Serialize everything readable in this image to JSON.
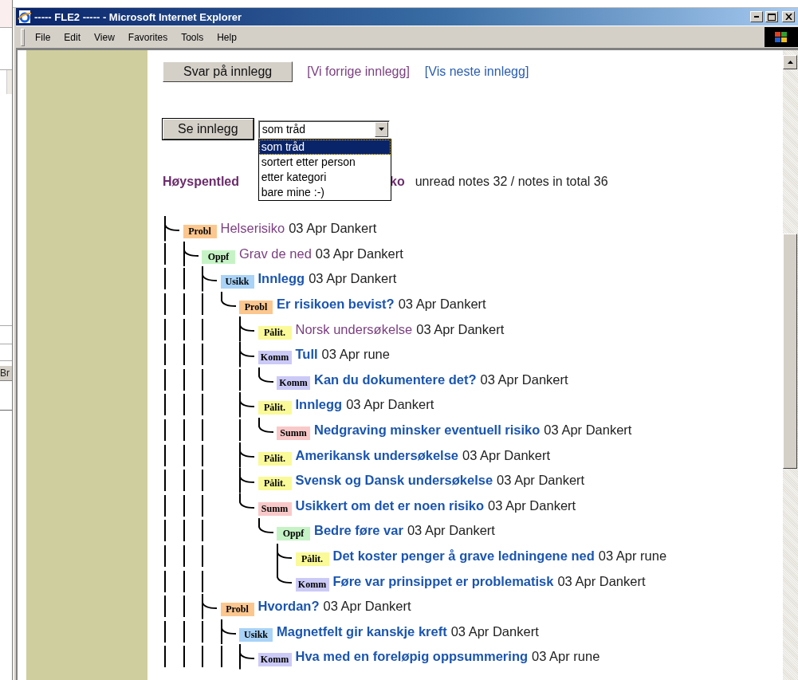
{
  "background_window": {
    "button_fragment": "Br"
  },
  "window": {
    "title": "----- FLE2 ----- - Microsoft Internet Explorer"
  },
  "menu": [
    "File",
    "Edit",
    "View",
    "Favorites",
    "Tools",
    "Help"
  ],
  "actions": {
    "reply_button": "Svar på innlegg",
    "links": [
      {
        "label": "[Vi forrige innlegg]",
        "visited": true
      },
      {
        "label": "[Vis neste innlegg]",
        "visited": false
      }
    ]
  },
  "view_form": {
    "button": "Se innlegg",
    "select_value": "som tråd",
    "options": [
      {
        "label": "som tråd",
        "selected": true
      },
      {
        "label": "sortert etter person",
        "selected": false
      },
      {
        "label": "etter kategori",
        "selected": false
      },
      {
        "label": "bare mine :-)",
        "selected": false
      }
    ]
  },
  "heading": {
    "title_start": "Høyspentled",
    "title_end": "ko",
    "counts": "unread notes 32 / notes in total 36"
  },
  "thread": [
    {
      "tag": "Probl",
      "color": "#fbc78f",
      "title": "Helserisiko",
      "meta": "03 Apr Dankert",
      "read": true,
      "last": false,
      "children": [
        {
          "tag": "Oppf",
          "color": "#c6f3c6",
          "title": "Grav de ned",
          "meta": "03 Apr Dankert",
          "read": true,
          "last": false,
          "children": [
            {
              "tag": "Usikk",
              "color": "#a9d3f7",
              "title": "Innlegg",
              "meta": "03 Apr Dankert",
              "read": false,
              "last": false,
              "children": [
                {
                  "tag": "Probl",
                  "color": "#fbc78f",
                  "title": "Er risikoen bevist?",
                  "meta": "03 Apr Dankert",
                  "read": false,
                  "last": true,
                  "children": [
                    {
                      "tag": "Pålit.",
                      "color": "#fafa98",
                      "title": "Norsk undersøkelse",
                      "meta": "03 Apr Dankert",
                      "read": true,
                      "last": false
                    },
                    {
                      "tag": "Komm",
                      "color": "#cbcaf7",
                      "title": "Tull",
                      "meta": "03 Apr rune",
                      "read": false,
                      "last": false,
                      "children": [
                        {
                          "tag": "Komm",
                          "color": "#cbcaf7",
                          "title": "Kan du dokumentere det?",
                          "meta": "03 Apr Dankert",
                          "read": false,
                          "last": true
                        }
                      ]
                    },
                    {
                      "tag": "Pålit.",
                      "color": "#fafa98",
                      "title": "Innlegg",
                      "meta": "03 Apr Dankert",
                      "read": false,
                      "last": false,
                      "children": [
                        {
                          "tag": "Summ",
                          "color": "#f9c9c9",
                          "title": "Nedgraving minsker eventuell risiko",
                          "meta": "03 Apr Dankert",
                          "read": false,
                          "last": true
                        }
                      ]
                    },
                    {
                      "tag": "Pålit.",
                      "color": "#fafa98",
                      "title": "Amerikansk undersøkelse",
                      "meta": "03 Apr Dankert",
                      "read": false,
                      "last": false
                    },
                    {
                      "tag": "Pålit.",
                      "color": "#fafa98",
                      "title": "Svensk og Dansk undersøkelse",
                      "meta": "03 Apr Dankert",
                      "read": false,
                      "last": false
                    },
                    {
                      "tag": "Summ",
                      "color": "#f9c9c9",
                      "title": "Usikkert om det er noen risiko",
                      "meta": "03 Apr Dankert",
                      "read": false,
                      "last": true,
                      "children": [
                        {
                          "tag": "Oppf",
                          "color": "#c6f3c6",
                          "title": "Bedre føre var",
                          "meta": "03 Apr Dankert",
                          "read": false,
                          "last": true,
                          "children": [
                            {
                              "tag": "Pålit.",
                              "color": "#fafa98",
                              "title": "Det koster penger å grave ledningene ned",
                              "meta": "03 Apr rune",
                              "read": false,
                              "last": false
                            },
                            {
                              "tag": "Komm",
                              "color": "#cbcaf7",
                              "title": "Føre var prinsippet er problematisk",
                              "meta": "03 Apr Dankert",
                              "read": false,
                              "last": true
                            }
                          ]
                        }
                      ]
                    }
                  ]
                }
              ]
            },
            {
              "tag": "Probl",
              "color": "#fbc78f",
              "title": "Hvordan?",
              "meta": "03 Apr Dankert",
              "read": false,
              "last": false,
              "children": [
                {
                  "tag": "Usikk",
                  "color": "#a9d3f7",
                  "title": "Magnetfelt gir kanskje kreft",
                  "meta": "03 Apr Dankert",
                  "read": false,
                  "last": false,
                  "children": [
                    {
                      "tag": "Komm",
                      "color": "#cbcaf7",
                      "title": "Hva med en foreløpig oppsummering",
                      "meta": "03 Apr rune",
                      "read": false,
                      "last": false
                    }
                  ]
                }
              ]
            }
          ]
        }
      ]
    }
  ]
}
